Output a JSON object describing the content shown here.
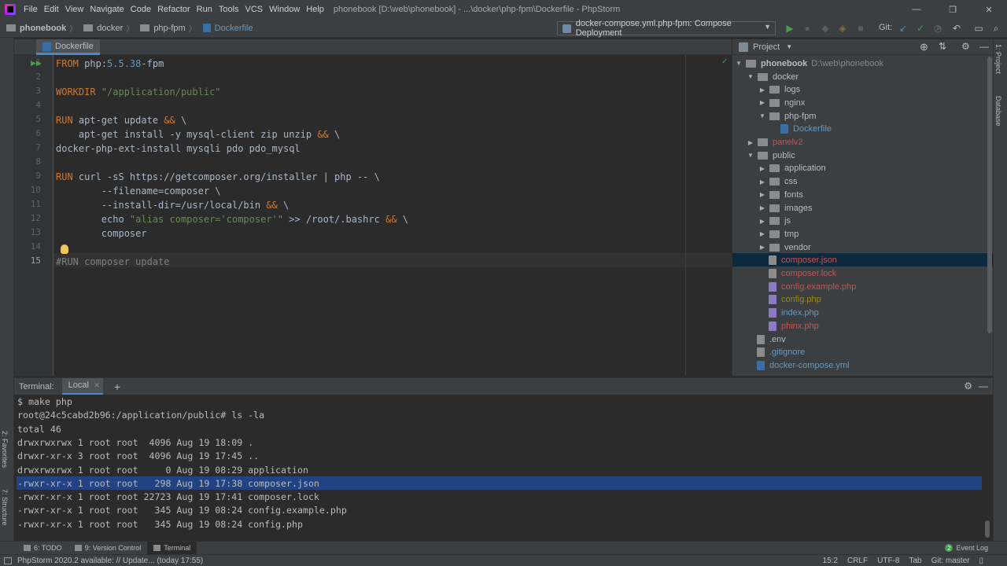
{
  "menubar": {
    "items": [
      "File",
      "Edit",
      "View",
      "Navigate",
      "Code",
      "Refactor",
      "Run",
      "Tools",
      "VCS",
      "Window",
      "Help"
    ],
    "title": "phonebook [D:\\web\\phonebook] - ...\\docker\\php-fpm\\Dockerfile - PhpStorm",
    "controls": [
      "—",
      "❐",
      "✕"
    ]
  },
  "navbar": {
    "crumbs": [
      "phonebook",
      "docker",
      "php-fpm",
      "Dockerfile"
    ],
    "run_config": "docker-compose.yml.php-fpm: Compose Deployment",
    "git_label": "Git:"
  },
  "editor": {
    "tab": "Dockerfile",
    "line_numbers": [
      "1",
      "2",
      "3",
      "4",
      "5",
      "6",
      "7",
      "8",
      "9",
      "10",
      "11",
      "12",
      "13",
      "14",
      "15"
    ],
    "lines": [
      [
        {
          "t": "FROM ",
          "c": "kw"
        },
        {
          "t": "php:",
          "c": ""
        },
        {
          "t": "5.5.38",
          "c": "num"
        },
        {
          "t": "-fpm",
          "c": ""
        }
      ],
      [],
      [
        {
          "t": "WORKDIR ",
          "c": "kw"
        },
        {
          "t": "\"/application/public\"",
          "c": "str"
        }
      ],
      [],
      [
        {
          "t": "RUN ",
          "c": "kw"
        },
        {
          "t": "apt-get update ",
          "c": ""
        },
        {
          "t": "&&",
          "c": "kw"
        },
        {
          "t": " \\",
          "c": ""
        }
      ],
      [
        {
          "t": "    apt-get install -y mysql-client zip unzip ",
          "c": ""
        },
        {
          "t": "&&",
          "c": "kw"
        },
        {
          "t": " \\",
          "c": ""
        }
      ],
      [
        {
          "t": "docker-php-ext-install mysqli pdo pdo_mysql",
          "c": ""
        }
      ],
      [],
      [
        {
          "t": "RUN ",
          "c": "kw"
        },
        {
          "t": "curl -sS https://getcomposer.org/installer | php -- \\",
          "c": ""
        }
      ],
      [
        {
          "t": "        --filename=composer \\",
          "c": ""
        }
      ],
      [
        {
          "t": "        --install-dir=/usr/local/bin ",
          "c": ""
        },
        {
          "t": "&&",
          "c": "kw"
        },
        {
          "t": " \\",
          "c": ""
        }
      ],
      [
        {
          "t": "        echo ",
          "c": ""
        },
        {
          "t": "\"alias composer='composer'\"",
          "c": "str"
        },
        {
          "t": " >> /root/.bashrc ",
          "c": ""
        },
        {
          "t": "&&",
          "c": "kw"
        },
        {
          "t": " \\",
          "c": ""
        }
      ],
      [
        {
          "t": "        composer",
          "c": ""
        }
      ],
      [],
      [
        {
          "t": "#RUN composer update",
          "c": "cmt"
        }
      ]
    ]
  },
  "project": {
    "header": "Project",
    "root_name": "phonebook",
    "root_path": "D:\\web\\phonebook",
    "tree": [
      {
        "label": "docker",
        "depth": 1,
        "type": "folder",
        "open": true,
        "color": "#bbbbbb"
      },
      {
        "label": "logs",
        "depth": 2,
        "type": "folder",
        "open": false,
        "color": "#bbbbbb"
      },
      {
        "label": "nginx",
        "depth": 2,
        "type": "folder",
        "open": false,
        "color": "#bbbbbb"
      },
      {
        "label": "php-fpm",
        "depth": 2,
        "type": "folder",
        "open": true,
        "color": "#bbbbbb"
      },
      {
        "label": "Dockerfile",
        "depth": 3,
        "type": "docker",
        "color": "#6897bb"
      },
      {
        "label": "panelv2",
        "depth": 1,
        "type": "folder",
        "open": false,
        "color": "#c75450"
      },
      {
        "label": "public",
        "depth": 1,
        "type": "folder",
        "open": true,
        "color": "#bbbbbb"
      },
      {
        "label": "application",
        "depth": 2,
        "type": "folder",
        "open": false,
        "color": "#bbbbbb"
      },
      {
        "label": "css",
        "depth": 2,
        "type": "folder",
        "open": false,
        "color": "#bbbbbb"
      },
      {
        "label": "fonts",
        "depth": 2,
        "type": "folder",
        "open": false,
        "color": "#bbbbbb"
      },
      {
        "label": "images",
        "depth": 2,
        "type": "folder",
        "open": false,
        "color": "#bbbbbb"
      },
      {
        "label": "js",
        "depth": 2,
        "type": "folder",
        "open": false,
        "color": "#bbbbbb"
      },
      {
        "label": "tmp",
        "depth": 2,
        "type": "folder",
        "open": false,
        "color": "#bbbbbb"
      },
      {
        "label": "vendor",
        "depth": 2,
        "type": "folder",
        "open": false,
        "color": "#bbbbbb"
      },
      {
        "label": "composer.json",
        "depth": 2,
        "type": "file",
        "color": "#c75450"
      },
      {
        "label": "composer.lock",
        "depth": 2,
        "type": "file",
        "color": "#c75450"
      },
      {
        "label": "config.example.php",
        "depth": 2,
        "type": "php",
        "color": "#c75450"
      },
      {
        "label": "config.php",
        "depth": 2,
        "type": "php",
        "color": "#9e880d"
      },
      {
        "label": "index.php",
        "depth": 2,
        "type": "php",
        "color": "#6897bb"
      },
      {
        "label": "phinx.php",
        "depth": 2,
        "type": "php",
        "color": "#c75450"
      },
      {
        "label": ".env",
        "depth": 1,
        "type": "file",
        "color": "#bbbbbb"
      },
      {
        "label": ".gitignore",
        "depth": 1,
        "type": "file",
        "color": "#6897bb"
      },
      {
        "label": "docker-compose.yml",
        "depth": 1,
        "type": "docker",
        "color": "#6897bb"
      }
    ]
  },
  "right_strip": {
    "tabs": [
      "1: Project",
      "Database"
    ]
  },
  "left_strip": {
    "tabs": [
      "2: Favorites",
      "7: Structure"
    ]
  },
  "terminal": {
    "label": "Terminal:",
    "tab": "Local",
    "lines": [
      "$ make php",
      "root@24c5cabd2b96:/application/public# ls -la",
      "total 46",
      "drwxrwxrwx 1 root root  4096 Aug 19 18:09 .",
      "drwxr-xr-x 3 root root  4096 Aug 19 17:45 ..",
      "drwxrwxrwx 1 root root     0 Aug 19 08:29 application",
      "-rwxr-xr-x 1 root root   298 Aug 19 17:38 composer.json",
      "-rwxr-xr-x 1 root root 22723 Aug 19 17:41 composer.lock",
      "-rwxr-xr-x 1 root root   345 Aug 19 08:24 config.example.php",
      "-rwxr-xr-x 1 root root   345 Aug 19 08:24 config.php"
    ]
  },
  "bottom_tools": {
    "todo": "6: TODO",
    "vcs": "9: Version Control",
    "terminal": "Terminal",
    "event_log": "Event Log",
    "event_count": "2"
  },
  "status": {
    "message": "PhpStorm 2020.2 available: // Update... (today 17:55)",
    "position": "15:2",
    "line_sep": "CRLF",
    "encoding": "UTF-8",
    "indent": "Tab",
    "branch": "Git: master"
  }
}
